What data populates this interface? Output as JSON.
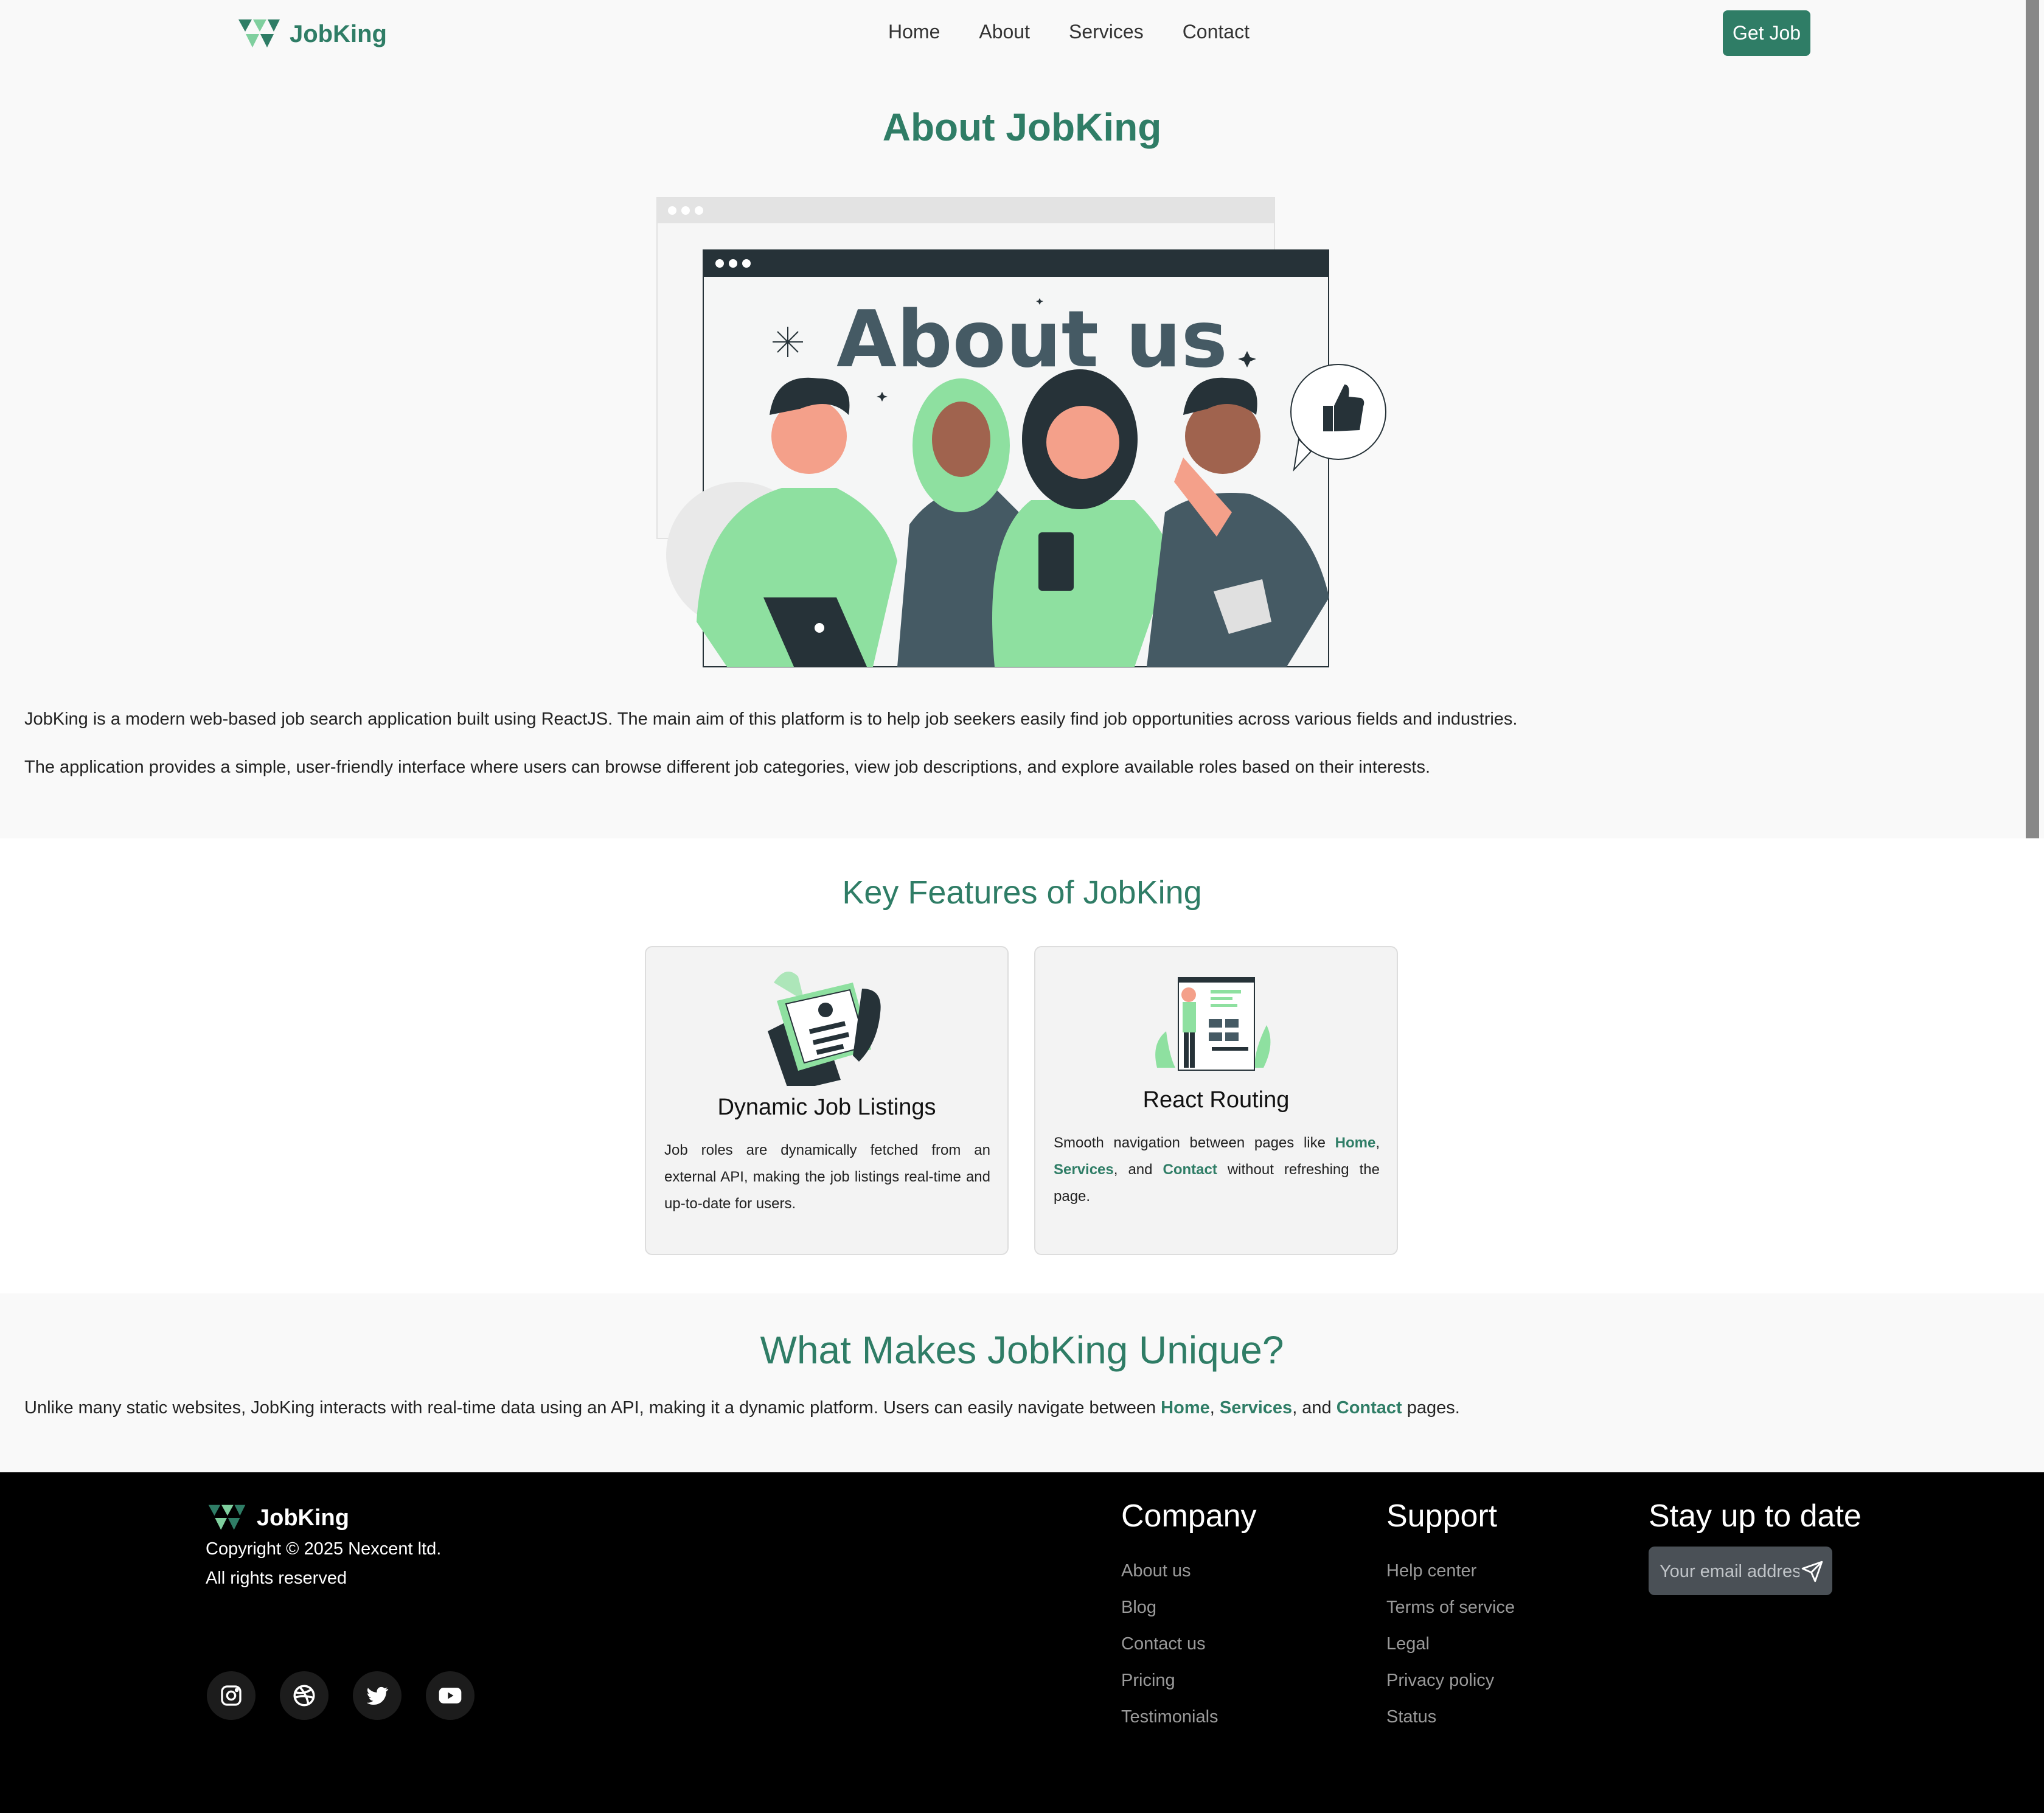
{
  "brand": {
    "name": "JobKing",
    "color": "#2f7d66"
  },
  "nav": {
    "links": [
      "Home",
      "About",
      "Services",
      "Contact"
    ],
    "cta": "Get Job"
  },
  "about": {
    "title": "About JobKing",
    "hero_text": "About us",
    "paragraphs": [
      "JobKing is a modern web-based job search application built using ReactJS. The main aim of this platform is to help job seekers easily find job opportunities across various fields and industries.",
      "The application provides a simple, user-friendly interface where users can browse different job categories, view job descriptions, and explore available roles based on their interests."
    ]
  },
  "features": {
    "title": "Key Features of JobKing",
    "cards": [
      {
        "title": "Dynamic Job Listings",
        "desc": "Job roles are dynamically fetched from an external API, making the job listings real-time and up-to-date for users."
      },
      {
        "title": "React Routing",
        "desc_prefix": "Smooth navigation between pages like ",
        "link1": "Home",
        "sep1": ", ",
        "link2": "Services",
        "sep2": ", and ",
        "link3": "Contact",
        "desc_suffix": " without refreshing the page."
      }
    ]
  },
  "unique": {
    "title": "What Makes JobKing Unique?",
    "text_prefix": "Unlike many static websites, JobKing interacts with real-time data using an API, making it a dynamic platform. Users can easily navigate between ",
    "link1": "Home",
    "sep1": ", ",
    "link2": "Services",
    "sep2": ", and ",
    "link3": "Contact",
    "text_suffix": " pages."
  },
  "footer": {
    "brand": "JobKing",
    "copyright": "Copyright © 2025 Nexcent ltd.",
    "rights": "All rights reserved",
    "social": [
      "instagram-icon",
      "dribbble-icon",
      "twitter-icon",
      "youtube-icon"
    ],
    "company": {
      "heading": "Company",
      "links": [
        "About us",
        "Blog",
        "Contact us",
        "Pricing",
        "Testimonials"
      ]
    },
    "support": {
      "heading": "Support",
      "links": [
        "Help center",
        "Terms of service",
        "Legal",
        "Privacy policy",
        "Status"
      ]
    },
    "newsletter": {
      "heading": "Stay up to date",
      "placeholder": "Your email address"
    }
  }
}
